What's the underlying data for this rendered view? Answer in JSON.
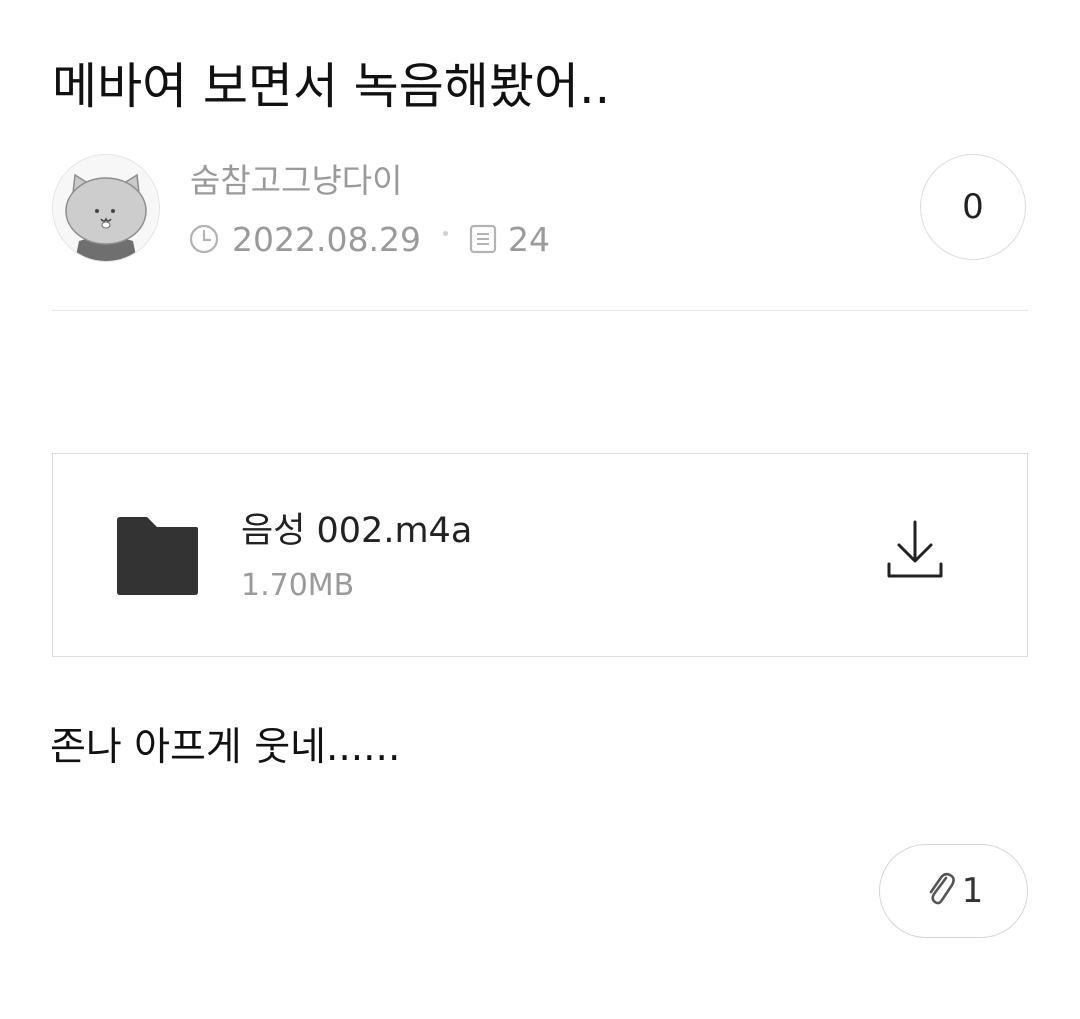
{
  "post": {
    "title": "메바여 보면서 녹음해봤어..",
    "author": "숨참고그냥다이",
    "date": "2022.08.29",
    "views": "24",
    "comment_count": "0",
    "body": "존나 아프게 웃네......"
  },
  "attachment": {
    "file_name": "음성 002.m4a",
    "file_size": "1.70MB",
    "count": "1"
  },
  "icons": {
    "clock": "clock-icon",
    "document": "document-icon",
    "folder": "folder-icon",
    "download": "download-icon",
    "paperclip": "paperclip-icon"
  },
  "colors": {
    "text_primary": "#111111",
    "text_secondary": "#9a9a9a",
    "border": "#dddddd",
    "folder": "#333333"
  }
}
